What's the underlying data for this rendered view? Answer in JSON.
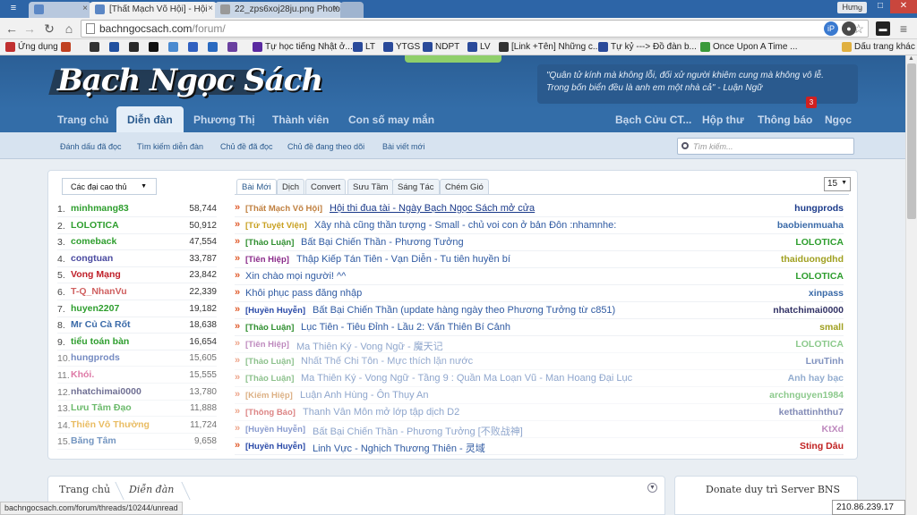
{
  "browser": {
    "tabs": [
      {
        "title": "[Thất Mạch Võ Hội] - Hội"
      },
      {
        "title": "22_zps6xoj28ju.png Photo"
      }
    ],
    "user": "Hưng",
    "url_host": "bachngocsach.com",
    "url_path": "/forum/",
    "bookmarks": [
      "Ứng dụng",
      "Tự học tiếng Nhật ở...",
      "LT",
      "YTGS",
      "NDPT",
      "LV",
      "[Link +Tên] Những c...",
      "Tự kỷ ---> Đồ đàn b...",
      "Once Upon A Time ...",
      "Dấu trang khác"
    ],
    "status_url": "bachngocsach.com/forum/threads/10244/unread",
    "ip": "210.86.239.17"
  },
  "site": {
    "logo": "Bạch Ngọc Sách",
    "quote_line1": "\"Quân tử kính mà không lỗi, đối xử người khiêm cung mà không vô lễ.",
    "quote_line2": "Trong bốn biển đều là anh em một nhà cả\" - Luận Ngữ",
    "nav": [
      "Trang chủ",
      "Diễn đàn",
      "Phương Thị",
      "Thành viên",
      "Con số may mắn"
    ],
    "nav_right": [
      "Bạch Cửu CT...",
      "Hộp thư",
      "Thông báo",
      "Ngọc"
    ],
    "notif_count": "3",
    "subnav": [
      "Đánh dấu đã đọc",
      "Tìm kiếm diễn đàn",
      "Chủ đề đã đọc",
      "Chủ đề đang theo dõi",
      "Bài viết mới"
    ],
    "search_placeholder": "Tìm kiếm..."
  },
  "leaderboard": {
    "select_label": "Các đại cao thủ",
    "rows": [
      {
        "rank": "1.",
        "name": "minhmang83",
        "points": "58,744",
        "color": "#2e9e2e"
      },
      {
        "rank": "2.",
        "name": "LOLOTICA",
        "points": "50,912",
        "color": "#2e9e2e"
      },
      {
        "rank": "3.",
        "name": "comeback",
        "points": "47,554",
        "color": "#2e9e2e"
      },
      {
        "rank": "4.",
        "name": "congtuan",
        "points": "33,787",
        "color": "#4a4aa0"
      },
      {
        "rank": "5.",
        "name": "Vong Mạng",
        "points": "23,842",
        "color": "#c0202a"
      },
      {
        "rank": "6.",
        "name": "T-Q_NhanVu",
        "points": "22,339",
        "color": "#d06060"
      },
      {
        "rank": "7.",
        "name": "huyen2207",
        "points": "19,182",
        "color": "#2e9e2e"
      },
      {
        "rank": "8.",
        "name": "Mr Củ Cà Rốt",
        "points": "18,638",
        "color": "#3a6aa8"
      },
      {
        "rank": "9.",
        "name": "tiểu toán bàn",
        "points": "16,654",
        "color": "#2e9e2e"
      },
      {
        "rank": "10.",
        "name": "hungprods",
        "points": "15,605",
        "color": "#3a5aa8"
      },
      {
        "rank": "11.",
        "name": "Khói.",
        "points": "15,555",
        "color": "#d04080"
      },
      {
        "rank": "12.",
        "name": "nhatchimai0000",
        "points": "13,780",
        "color": "#333366"
      },
      {
        "rank": "13.",
        "name": "Lưu Tâm Đạo",
        "points": "11,888",
        "color": "#2e9e2e"
      },
      {
        "rank": "14.",
        "name": "Thiên Vô Thường",
        "points": "11,724",
        "color": "#e0a020"
      },
      {
        "rank": "15.",
        "name": "Băng Tâm",
        "points": "9,658",
        "color": "#3a6aa8"
      }
    ]
  },
  "threads": {
    "tabs": [
      "Bài Mới",
      "Dịch",
      "Convert",
      "Sưu Tầm",
      "Sáng Tác",
      "Chém Gió"
    ],
    "per_page": "15",
    "rows": [
      {
        "prefix": "[Thất Mạch Võ Hội]",
        "prefix_color": "#c08040",
        "title": "Hội thi đua tài - Ngày Bạch Ngọc Sách mở cửa",
        "author": "hungprods",
        "author_color": "#1a3a8a"
      },
      {
        "prefix": "[Tứ Tuyệt Viện]",
        "prefix_color": "#c8a020",
        "title": "Xây nhà cũng thần tượng - Small - chủ voi con ở bản Đôn :nhamnhe:",
        "author": "baobienmuaha",
        "author_color": "#3a6aa8"
      },
      {
        "prefix": "[Thảo Luận]",
        "prefix_color": "#2e8e2e",
        "title": "Bất Bại Chiến Thần - Phương Tưởng",
        "author": "LOLOTICA",
        "author_color": "#2e9e2e"
      },
      {
        "prefix": "[Tiên Hiệp]",
        "prefix_color": "#8a2a8a",
        "title": "Thập Kiếp Tán Tiên - Vạn Diễn - Tu tiên huyền bí",
        "author": "thaiduongdhd",
        "author_color": "#a0a020"
      },
      {
        "prefix": "",
        "prefix_color": "#333",
        "title": "Xin chào mọi người! ^^",
        "author": "LOLOTICA",
        "author_color": "#2e9e2e"
      },
      {
        "prefix": "",
        "prefix_color": "#333",
        "title": "Khôi phục pass đăng nhập",
        "author": "xinpass",
        "author_color": "#3a6aa8"
      },
      {
        "prefix": "[Huyền Huyễn]",
        "prefix_color": "#2a4aa8",
        "title": "Bất Bại Chiến Thần (update hàng ngày theo Phương Tưởng từ c851)",
        "author": "nhatchimai0000",
        "author_color": "#333366"
      },
      {
        "prefix": "[Thảo Luận]",
        "prefix_color": "#2e8e2e",
        "title": "Lục Tiên - Tiêu Đỉnh - Lầu 2: Vấn Thiên Bí Cảnh",
        "author": "small",
        "author_color": "#a0a020"
      },
      {
        "prefix": "[Tiên Hiệp]",
        "prefix_color": "#8a2a8a",
        "title": "Ma Thiên Ký - Vong Ngữ - 魔天记",
        "author": "LOLOTICA",
        "author_color": "#2e9e2e"
      },
      {
        "prefix": "[Thảo Luận]",
        "prefix_color": "#2e8e2e",
        "title": "Nhất Thế Chi Tôn - Mực thích lặn nước",
        "author": "LưuTinh",
        "author_color": "#1a3a8a"
      },
      {
        "prefix": "[Thảo Luận]",
        "prefix_color": "#2e8e2e",
        "title": "Ma Thiên Ký - Vong Ngữ - Tầng 9 : Quần Ma Loạn Vũ - Man Hoang Đại Lục",
        "author": "Anh hay bạc",
        "author_color": "#3a6aa8"
      },
      {
        "prefix": "[Kiếm Hiệp]",
        "prefix_color": "#c07020",
        "title": "Luận Anh Hùng - Ôn Thụy An",
        "author": "archnguyen1984",
        "author_color": "#2e9e2e"
      },
      {
        "prefix": "[Thông Báo]",
        "prefix_color": "#c02020",
        "title": "Thanh Vân Môn mở lớp tập dịch D2",
        "author": "kethattinhthu7",
        "author_color": "#1a2a7a"
      },
      {
        "prefix": "[Huyền Huyễn]",
        "prefix_color": "#2a4aa8",
        "title": "Bất Bại Chiến Thần - Phương Tưởng [不败战神]",
        "author": "KtXd",
        "author_color": "#8a2a8a"
      },
      {
        "prefix": "[Huyền Huyễn]",
        "prefix_color": "#2a4aa8",
        "title": "Linh Vực - Nghịch Thương Thiên - 灵域",
        "author": "Sting Dâu",
        "author_color": "#c02020"
      }
    ]
  },
  "bottom": {
    "breadcrumb": [
      "Trang chủ",
      "Diễn đàn"
    ],
    "donate": "Donate duy trì Server BNS"
  }
}
